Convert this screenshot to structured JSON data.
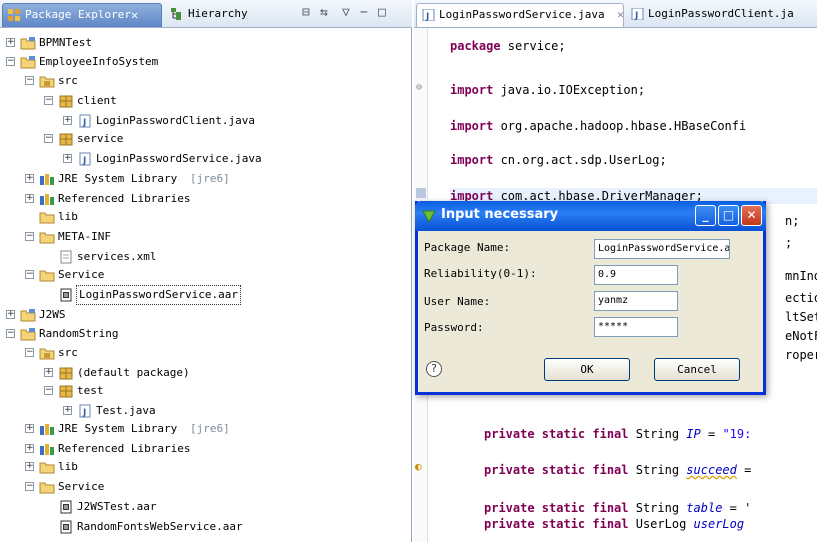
{
  "left_panel": {
    "tabs": [
      {
        "label": "Package Explorer",
        "close": "✕"
      },
      {
        "label": "Hierarchy"
      }
    ],
    "tree": [
      {
        "label": "BPMNTest",
        "icon": "project-icon",
        "expander": "+",
        "indent": 0
      },
      {
        "label": "EmployeeInfoSystem",
        "icon": "project-icon",
        "expander": "−",
        "indent": 0
      },
      {
        "label": "src",
        "icon": "source-folder-icon",
        "expander": "−",
        "indent": 1
      },
      {
        "label": "client",
        "icon": "package-icon",
        "expander": "−",
        "indent": 2
      },
      {
        "label": "LoginPasswordClient.java",
        "icon": "java-file-icon",
        "expander": "+",
        "indent": 3
      },
      {
        "label": "service",
        "icon": "package-icon",
        "expander": "−",
        "indent": 2
      },
      {
        "label": "LoginPasswordService.java",
        "icon": "java-file-icon",
        "expander": "+",
        "indent": 3
      },
      {
        "label": "JRE System Library",
        "decoration": "[jre6]",
        "icon": "library-icon",
        "expander": "+",
        "indent": 1
      },
      {
        "label": "Referenced Libraries",
        "icon": "library-icon",
        "expander": "+",
        "indent": 1
      },
      {
        "label": "lib",
        "icon": "folder-icon",
        "expander": "",
        "indent": 1
      },
      {
        "label": "META-INF",
        "icon": "folder-icon",
        "expander": "−",
        "indent": 1
      },
      {
        "label": "services.xml",
        "icon": "xml-file-icon",
        "expander": "",
        "indent": 2
      },
      {
        "label": "Service",
        "icon": "folder-icon",
        "expander": "−",
        "indent": 1
      },
      {
        "label": "LoginPasswordService.aar",
        "icon": "archive-icon",
        "expander": "",
        "indent": 2,
        "selected": true
      },
      {
        "label": "J2WS",
        "icon": "project-icon",
        "expander": "+",
        "indent": 0
      },
      {
        "label": "RandomString",
        "icon": "project-icon",
        "expander": "−",
        "indent": 0
      },
      {
        "label": "src",
        "icon": "source-folder-icon",
        "expander": "−",
        "indent": 1
      },
      {
        "label": "(default package)",
        "icon": "package-icon",
        "expander": "+",
        "indent": 2
      },
      {
        "label": "test",
        "icon": "package-icon",
        "expander": "−",
        "indent": 2
      },
      {
        "label": "Test.java",
        "icon": "java-file-icon",
        "expander": "+",
        "indent": 3
      },
      {
        "label": "JRE System Library",
        "decoration": "[jre6]",
        "icon": "library-icon",
        "expander": "+",
        "indent": 1
      },
      {
        "label": "Referenced Libraries",
        "icon": "library-icon",
        "expander": "+",
        "indent": 1
      },
      {
        "label": "lib",
        "icon": "folder-icon",
        "expander": "+",
        "indent": 1
      },
      {
        "label": "Service",
        "icon": "folder-icon",
        "expander": "−",
        "indent": 1
      },
      {
        "label": "J2WSTest.aar",
        "icon": "archive-icon",
        "expander": "",
        "indent": 2
      },
      {
        "label": "RandomFontsWebService.aar",
        "icon": "archive-icon",
        "expander": "",
        "indent": 2
      }
    ]
  },
  "editor": {
    "tabs": [
      {
        "label": "LoginPasswordService.java",
        "close": "✕"
      },
      {
        "label": "LoginPasswordClient.ja"
      }
    ],
    "lines": {
      "package_kw": "package",
      "package_rest": " service;",
      "import1_kw": "import",
      "import1_rest": " java.io.IOException;",
      "import2_kw": "import",
      "import2_rest": " org.apache.hadoop.hbase.HBaseConfi",
      "import3_kw": "import",
      "import3_rest": " cn.org.act.sdp.UserLog;",
      "frag1": "n;",
      "frag2": ";",
      "frag3": "mnInde",
      "frag4": "ection",
      "frag5": "ltSetl",
      "frag6": "eNotFo",
      "frag7": "ropert",
      "ip_kw": "private static final",
      "ip_type": " String ",
      "ip_field": "IP",
      "ip_rest": " = ",
      "ip_str": "\"19:",
      "succ_kw": "private static final",
      "succ_type": " String ",
      "succ_field": "succeed",
      "succ_rest": " =",
      "table_kw": "private static final",
      "table_type": " String ",
      "table_field": "table",
      "table_rest": " = '",
      "ul_kw": "private static final",
      "ul_type": " UserLog ",
      "ul_field": "userLog"
    }
  },
  "dialog": {
    "title": "Input necessary",
    "fields": {
      "package_label": "Package Name:",
      "package_value": "LoginPasswordService.aar",
      "reliability_label": "Reliability(0-1):",
      "reliability_value": "0.9",
      "user_label": "User Name:",
      "user_value": "yanmz",
      "password_label": "Password:",
      "password_value": "*****"
    },
    "ok_label": "OK",
    "cancel_label": "Cancel",
    "help_glyph": "?",
    "window_buttons": {
      "minimize": "_",
      "maximize": "□",
      "close": "✕"
    }
  },
  "colors": {
    "accent": "#0a5fe0",
    "keyword": "#7f0055",
    "string": "#2a00ff",
    "field": "#0000c0"
  }
}
